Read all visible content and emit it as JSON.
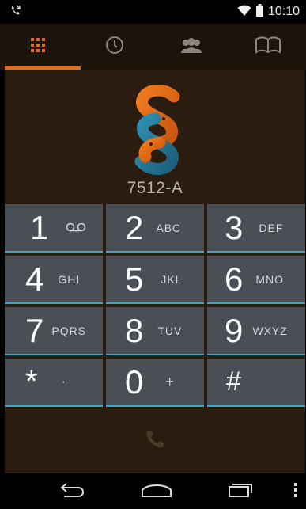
{
  "status_bar": {
    "time": "10:10",
    "icons": [
      "voicemail-icon",
      "wifi-icon",
      "battery-icon"
    ]
  },
  "tabs": [
    {
      "name": "dialpad",
      "icon": "dialpad-grid-icon",
      "active": true
    },
    {
      "name": "recents",
      "icon": "clock-icon",
      "active": false
    },
    {
      "name": "contacts",
      "icon": "contacts-group-icon",
      "active": false
    },
    {
      "name": "directory",
      "icon": "open-book-icon",
      "active": false
    }
  ],
  "account": {
    "label": "7512-A"
  },
  "dialpad": {
    "keys": [
      {
        "digit": "1",
        "letters": "",
        "icon": "voicemail-icon"
      },
      {
        "digit": "2",
        "letters": "ABC"
      },
      {
        "digit": "3",
        "letters": "DEF"
      },
      {
        "digit": "4",
        "letters": "GHI"
      },
      {
        "digit": "5",
        "letters": "JKL"
      },
      {
        "digit": "6",
        "letters": "MNO"
      },
      {
        "digit": "7",
        "letters": "PQRS"
      },
      {
        "digit": "8",
        "letters": "TUV"
      },
      {
        "digit": "9",
        "letters": "WXYZ"
      },
      {
        "digit": "*",
        "letters": "·"
      },
      {
        "digit": "0",
        "letters": "+"
      },
      {
        "digit": "#",
        "letters": ""
      }
    ]
  },
  "colors": {
    "accent": "#e56b16",
    "key_background": "#4a4f55",
    "key_underline": "#3ea7c4",
    "panel_background": "#2a1c0e",
    "tab_background": "#1c130a"
  },
  "nav_bar": {
    "buttons": [
      "back-icon",
      "home-icon",
      "recent-apps-icon",
      "overflow-menu-icon"
    ]
  }
}
